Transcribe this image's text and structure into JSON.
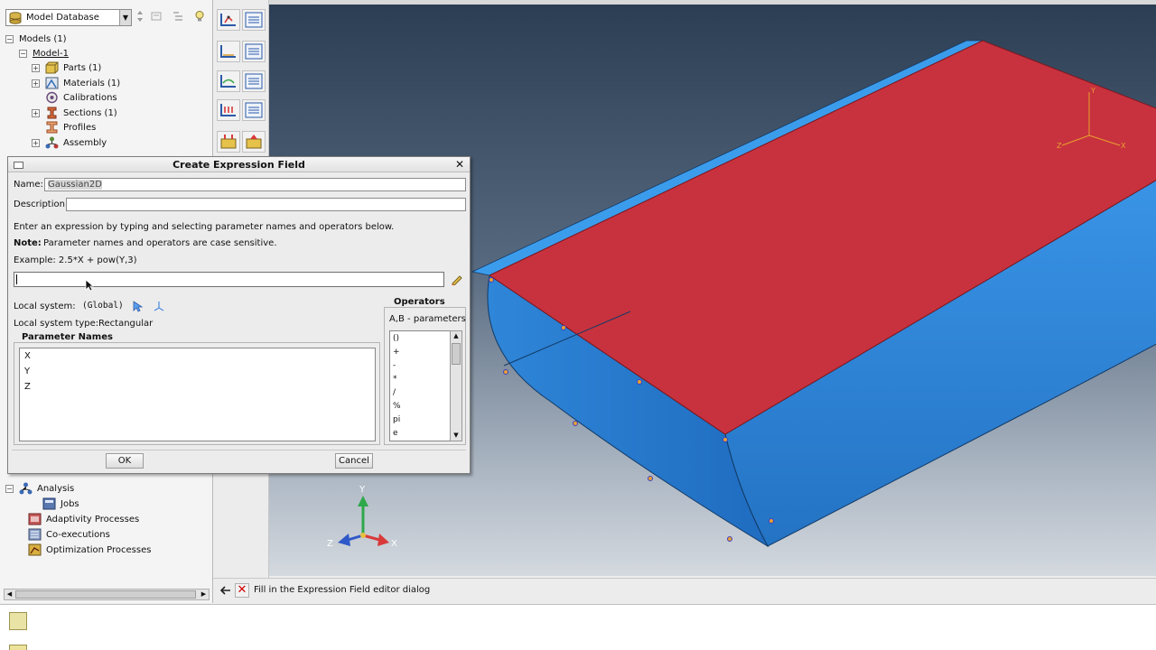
{
  "model_tree": {
    "selector": "Model Database",
    "items": [
      {
        "label": "Models (1)",
        "expander": "−"
      },
      {
        "label": "Model-1",
        "expander": "−"
      },
      {
        "label": "Parts (1)",
        "expander": "+"
      },
      {
        "label": "Materials (1)",
        "expander": "+"
      },
      {
        "label": "Calibrations",
        "expander": ""
      },
      {
        "label": "Sections (1)",
        "expander": "+"
      },
      {
        "label": "Profiles",
        "expander": ""
      },
      {
        "label": "Assembly",
        "expander": "+"
      }
    ],
    "lower_items": [
      {
        "label": "Analysis",
        "expander": "−"
      },
      {
        "label": "Jobs",
        "expander": ""
      },
      {
        "label": "Adaptivity Processes",
        "expander": ""
      },
      {
        "label": "Co-executions",
        "expander": ""
      },
      {
        "label": "Optimization Processes",
        "expander": ""
      }
    ]
  },
  "dialog": {
    "title": "Create Expression Field",
    "name_label": "Name:",
    "name_value": "Gaussian2D",
    "description_label": "Description:",
    "description_value": "",
    "instruction": "Enter an expression by typing and selecting parameter names and operators below.",
    "note_label": "Note:",
    "note_text": "Parameter names and operators are case sensitive.",
    "example": "Example:  2.5*X + pow(Y,3)",
    "expression_value": "",
    "local_system_label": "Local system:",
    "local_system_value": "(Global)",
    "local_system_type_label": "Local system type:",
    "local_system_type_value": "Rectangular",
    "parameter_names_title": "Parameter Names",
    "parameters": [
      "X",
      "Y",
      "Z"
    ],
    "operators_title": "Operators",
    "operators_subtitle": "A,B - parameters",
    "operators": [
      "()",
      "+",
      "-",
      "*",
      "/",
      "%",
      "pi",
      "e"
    ],
    "ok_label": "OK",
    "cancel_label": "Cancel"
  },
  "viewport": {
    "triad_top": {
      "x": "X",
      "y": "Y",
      "z": "Z"
    },
    "triad_bottom": {
      "x": "X",
      "y": "Y",
      "z": "Z"
    },
    "colors": {
      "part_blue": "#2f86d8",
      "face_red": "#c8323e",
      "triad_x": "#d83a3a",
      "triad_y": "#2fa84a",
      "triad_z": "#2f59c8"
    }
  },
  "prompt": {
    "text": "Fill in the Expression Field editor dialog"
  }
}
